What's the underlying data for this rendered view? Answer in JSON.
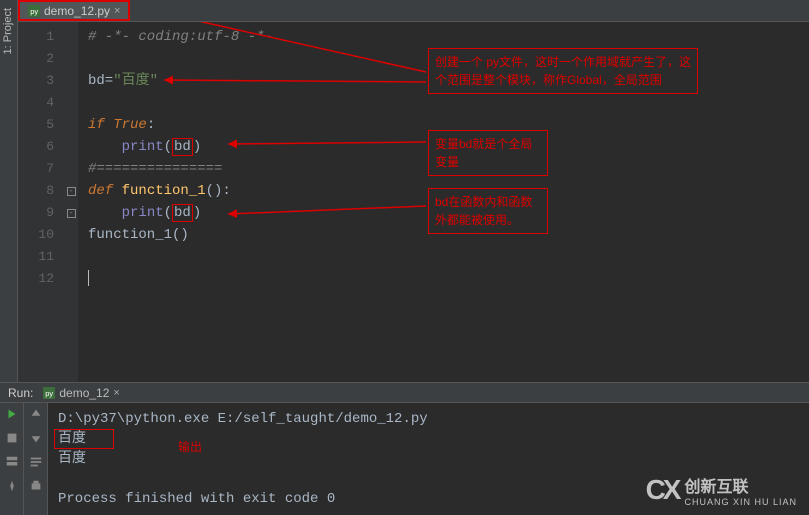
{
  "sidebar": {
    "project_label": "1: Project"
  },
  "tab": {
    "filename": "demo_12.py"
  },
  "gutter": {
    "lines": [
      "1",
      "2",
      "3",
      "4",
      "5",
      "6",
      "7",
      "8",
      "9",
      "10",
      "11",
      "12"
    ]
  },
  "code": {
    "l1_comment": "# -*- coding:utf-8 -*-",
    "l3_assign_left": "bd=",
    "l3_string": "\"百度\"",
    "l5_if": "if ",
    "l5_true": "True",
    "l5_colon": ":",
    "l6_print": "print",
    "l6_open": "(",
    "l6_bd": "bd",
    "l6_close": ")",
    "l7_sep": "#===============",
    "l8_def": "def ",
    "l8_name": "function_1",
    "l8_sig": "():",
    "l9_print": "print",
    "l9_open": "(",
    "l9_bd": "bd",
    "l9_close": ")",
    "l10_call": "function_1()"
  },
  "annotations": {
    "a1": "创建一个 py文件，这时一个作用域就产生了，这个范围是整个模块，称作Global，全局范围",
    "a2": "变量bd就是个全局变量",
    "a3": "bd在函数内和函数外都能被使用。"
  },
  "run": {
    "label": "Run:",
    "tab_name": "demo_12",
    "cmd": "D:\\py37\\python.exe E:/self_taught/demo_12.py",
    "out1": "百度",
    "out2": "百度",
    "out_label": "输出",
    "exit": "Process finished with exit code 0"
  },
  "watermark": {
    "brand": "创新互联",
    "sub": "CHUANG XIN HU LIAN"
  }
}
